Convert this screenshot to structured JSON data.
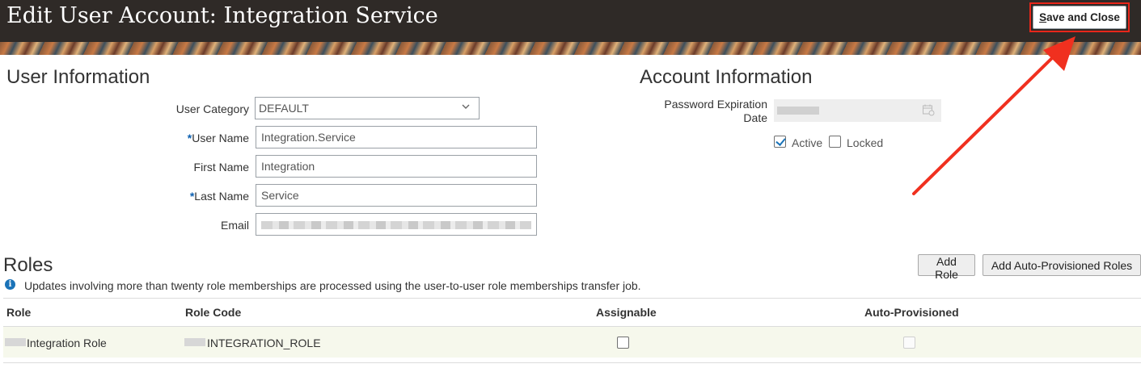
{
  "header": {
    "title": "Edit User Account: Integration Service",
    "save_close_label": "Save and Close",
    "save_close_mnemonic": "S"
  },
  "user_info": {
    "section_title": "User Information",
    "user_category": {
      "label": "User Category",
      "value": "DEFAULT"
    },
    "user_name": {
      "label": "User Name",
      "required_marker": "*",
      "value": "Integration.Service"
    },
    "first_name": {
      "label": "First Name",
      "value": "Integration"
    },
    "last_name": {
      "label": "Last Name",
      "required_marker": "*",
      "value": "Service"
    },
    "email": {
      "label": "Email"
    }
  },
  "account_info": {
    "section_title": "Account Information",
    "password_expiration": {
      "label_line1": "Password Expiration",
      "label_line2": "Date"
    },
    "active": {
      "label": "Active",
      "checked": true
    },
    "locked": {
      "label": "Locked",
      "checked": false
    }
  },
  "roles": {
    "section_title": "Roles",
    "add_role_label": "Add Role",
    "add_auto_label": "Add Auto-Provisioned Roles",
    "info_message": "Updates involving more than twenty role memberships are processed using the user-to-user role memberships transfer job.",
    "columns": [
      "Role",
      "Role Code",
      "Assignable",
      "Auto-Provisioned"
    ],
    "rows": [
      {
        "role": "Integration Role",
        "role_code": "INTEGRATION_ROLE",
        "assignable": false,
        "auto_provisioned": false
      }
    ]
  },
  "colors": {
    "header_bg": "#2f2a27",
    "highlight": "#e8261a",
    "accent": "#1a73b8",
    "row_bg": "#f6f8ec"
  },
  "icons": {
    "dropdown": "chevron-down-icon",
    "calendar": "calendar-icon",
    "info": "info-icon",
    "annotation": "arrow-annotation"
  }
}
